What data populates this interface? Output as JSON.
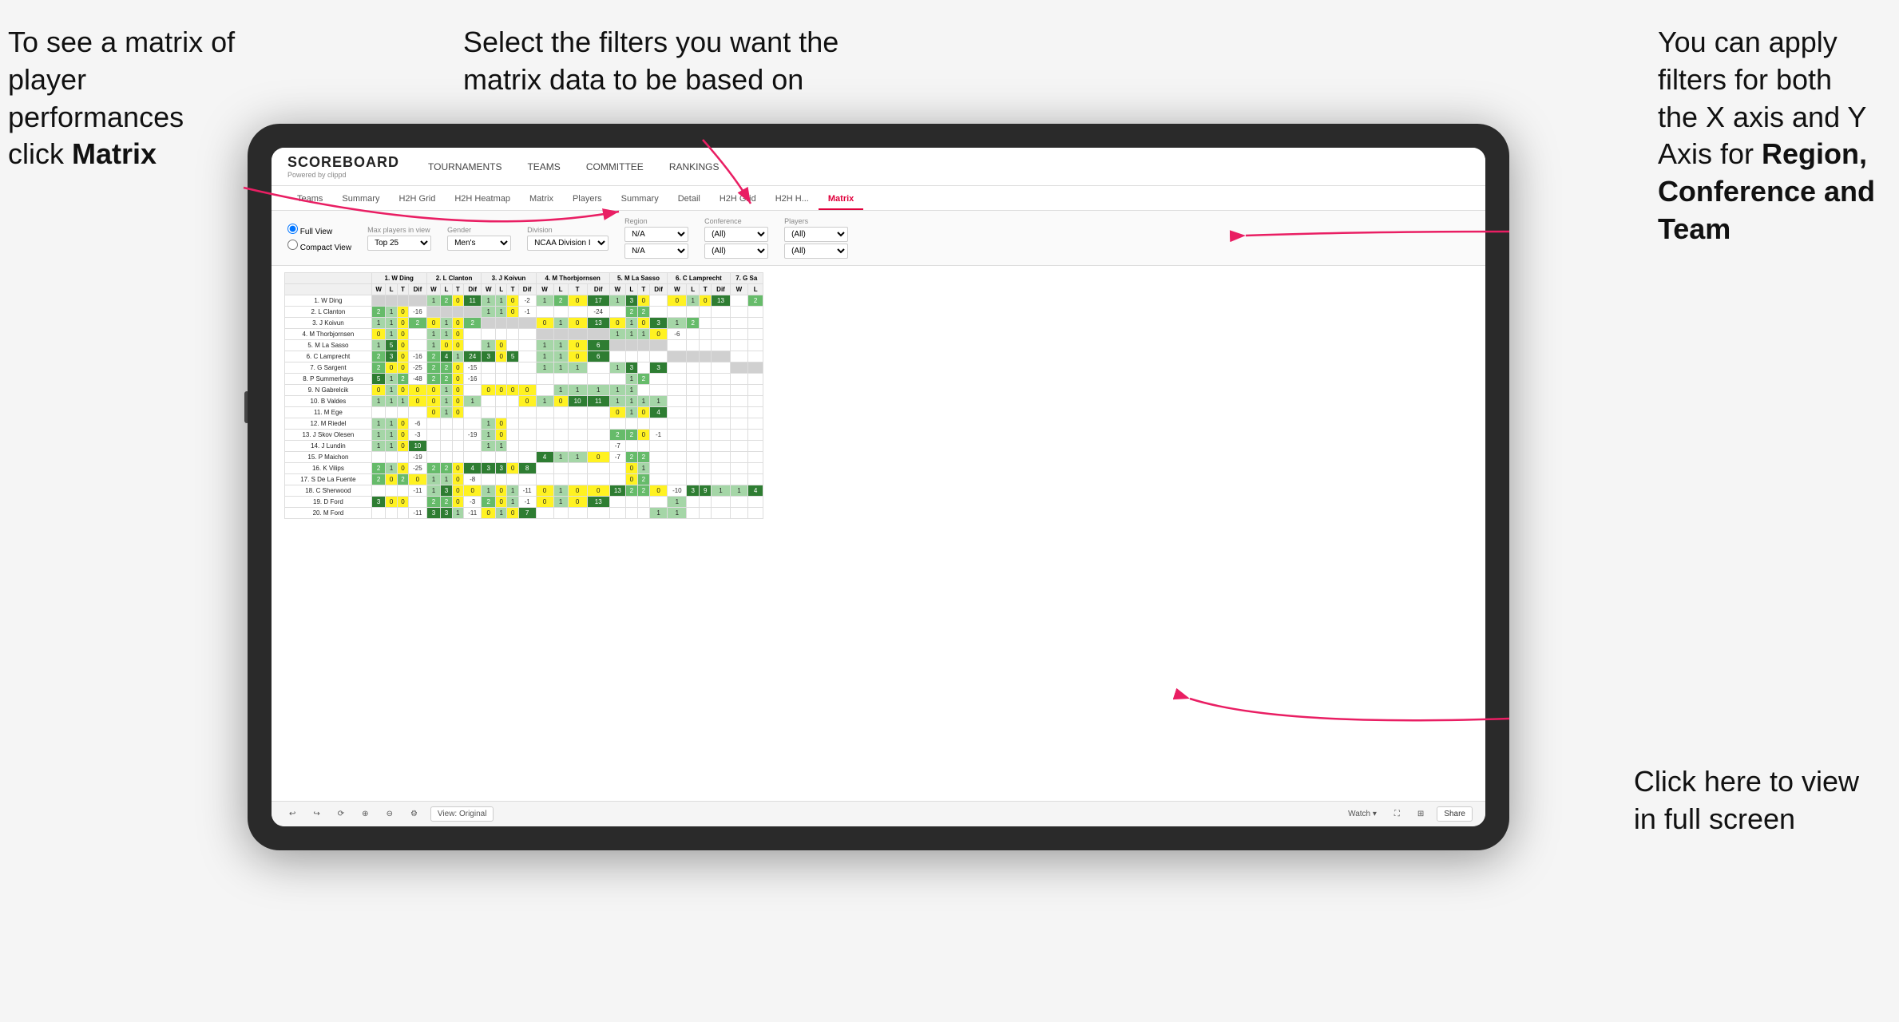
{
  "annotations": {
    "top_left": {
      "line1": "To see a matrix of",
      "line2": "player performances",
      "line3_prefix": "click ",
      "line3_bold": "Matrix"
    },
    "top_center": {
      "line1": "Select the filters you want the",
      "line2": "matrix data to be based on"
    },
    "top_right": {
      "line1": "You  can apply",
      "line2": "filters for both",
      "line3": "the X axis and Y",
      "line4_prefix": "Axis for ",
      "line4_bold": "Region,",
      "line5_bold": "Conference and",
      "line6_bold": "Team"
    },
    "bottom_right": {
      "line1": "Click here to view",
      "line2": "in full screen"
    }
  },
  "scoreboard": {
    "logo": "SCOREBOARD",
    "logo_sub": "Powered by clippd",
    "nav_items": [
      "TOURNAMENTS",
      "TEAMS",
      "COMMITTEE",
      "RANKINGS"
    ]
  },
  "sub_nav": {
    "items": [
      "Teams",
      "Summary",
      "H2H Grid",
      "H2H Heatmap",
      "Matrix",
      "Players",
      "Summary",
      "Detail",
      "H2H Grid",
      "H2H H...",
      "Matrix"
    ]
  },
  "filters": {
    "view_options": [
      "Full View",
      "Compact View"
    ],
    "max_players_label": "Max players in view",
    "max_players_value": "Top 25",
    "gender_label": "Gender",
    "gender_value": "Men's",
    "division_label": "Division",
    "division_value": "NCAA Division I",
    "region_label": "Region",
    "region_value1": "N/A",
    "region_value2": "N/A",
    "conference_label": "Conference",
    "conference_value1": "(All)",
    "conference_value2": "(All)",
    "players_label": "Players",
    "players_value1": "(All)",
    "players_value2": "(All)"
  },
  "matrix_headers": [
    "1. W Ding",
    "2. L Clanton",
    "3. J Koivun",
    "4. M Thorbjornsen",
    "5. M La Sasso",
    "6. C Lamprecht",
    "7. G Sa"
  ],
  "matrix_col_headers": [
    "W",
    "L",
    "T",
    "Dif"
  ],
  "players": [
    "1. W Ding",
    "2. L Clanton",
    "3. J Koivun",
    "4. M Thorbjornsen",
    "5. M La Sasso",
    "6. C Lamprecht",
    "7. G Sargent",
    "8. P Summerhays",
    "9. N Gabrelcik",
    "10. B Valdes",
    "11. M Ege",
    "12. M Riedel",
    "13. J Skov Olesen",
    "14. J Lundin",
    "15. P Maichon",
    "16. K Vilips",
    "17. S De La Fuente",
    "18. C Sherwood",
    "19. D Ford",
    "20. M Ford"
  ],
  "bottom_bar": {
    "view_original": "View: Original",
    "watch": "Watch ▾",
    "share": "Share"
  }
}
